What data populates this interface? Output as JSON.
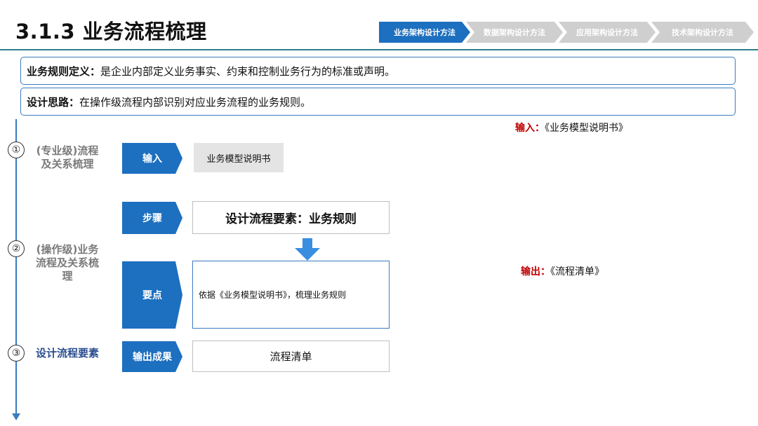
{
  "title": "3.1.3 业务流程梳理",
  "nav": [
    {
      "label": "业务架构设计方法",
      "active": true
    },
    {
      "label": "数据架构设计方法",
      "active": false
    },
    {
      "label": "应用架构设计方法",
      "active": false
    },
    {
      "label": "技术架构设计方法",
      "active": false
    }
  ],
  "definition": {
    "label": "业务规则定义：",
    "text": "是企业内部定义业务事实、约束和控制业务行为的标准或声明。"
  },
  "design_idea": {
    "label": "设计思路：",
    "text": "在操作级流程内部识别对应业务流程的业务规则。"
  },
  "phases": [
    {
      "num": "①",
      "label": "(专业级)流程及关系梳理"
    },
    {
      "num": "②",
      "label": "(操作级)业务流程及关系梳理"
    },
    {
      "num": "③",
      "label": "设计流程要素"
    }
  ],
  "steps": {
    "input": {
      "tag": "输入",
      "content": "业务模型说明书"
    },
    "step": {
      "tag": "步骤",
      "content": "设计流程要素：业务规则"
    },
    "keypoint": {
      "tag": "要点",
      "content": "依据《业务模型说明书》，梳理业务规则"
    },
    "output": {
      "tag": "输出成果",
      "content": "流程清单"
    }
  },
  "notes": {
    "input_label": "输入：",
    "input_value": "《业务模型说明书》",
    "output_label": "输出：",
    "output_value": "《流程清单》"
  },
  "colors": {
    "accent": "#1d6fbf",
    "inactive": "#cfcfcf",
    "highlight": "#c00000",
    "line": "#2e7d8c"
  }
}
